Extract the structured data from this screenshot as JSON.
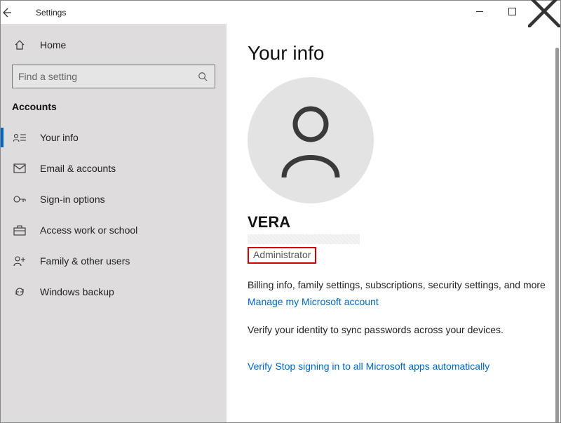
{
  "window": {
    "title": "Settings",
    "back_icon": "arrow-left",
    "controls": {
      "minimize": "−",
      "maximize": "□",
      "close": "×"
    }
  },
  "sidebar": {
    "home_label": "Home",
    "search_placeholder": "Find a setting",
    "category_label": "Accounts",
    "items": [
      {
        "label": "Your info",
        "active": true
      },
      {
        "label": "Email & accounts",
        "active": false
      },
      {
        "label": "Sign-in options",
        "active": false
      },
      {
        "label": "Access work or school",
        "active": false
      },
      {
        "label": "Family & other users",
        "active": false
      },
      {
        "label": "Windows backup",
        "active": false
      }
    ]
  },
  "content": {
    "heading": "Your info",
    "user_name": "VERA",
    "user_role": "Administrator",
    "billing_text": "Billing info, family settings, subscriptions, security settings, and more",
    "manage_link": "Manage my Microsoft account",
    "verify_text": "Verify your identity to sync passwords across your devices.",
    "verify_link": "Verify",
    "stop_link": "Stop signing in to all Microsoft apps automatically"
  }
}
